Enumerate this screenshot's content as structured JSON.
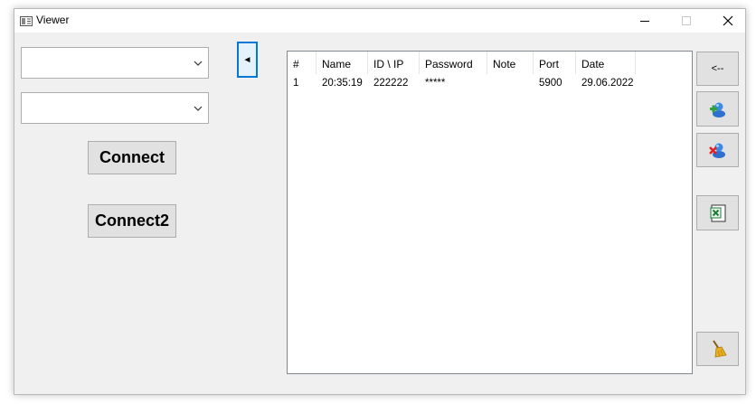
{
  "window": {
    "title": "Viewer"
  },
  "left_panel": {
    "combo1": {
      "value": ""
    },
    "combo2": {
      "value": ""
    },
    "connect_label": "Connect",
    "connect2_label": "Connect2",
    "arrow_label": "◄"
  },
  "list": {
    "columns": [
      "#",
      "Name",
      "ID \\ IP",
      "Password",
      "Note",
      "Port",
      "Date"
    ],
    "rows": [
      {
        "num": "1",
        "name": "20:35:19",
        "id_ip": "222222",
        "password": "*****",
        "note": "",
        "port": "5900",
        "date": "29.06.2022"
      }
    ]
  },
  "side_buttons": {
    "back_label": "<--",
    "add_icon": "add-user-icon",
    "remove_icon": "remove-user-icon",
    "excel_icon": "excel-icon",
    "clear_icon": "broom-icon"
  },
  "colors": {
    "focus_border": "#0078d7",
    "button_face": "#e1e1e1",
    "window_bg": "#f0f0f0"
  }
}
